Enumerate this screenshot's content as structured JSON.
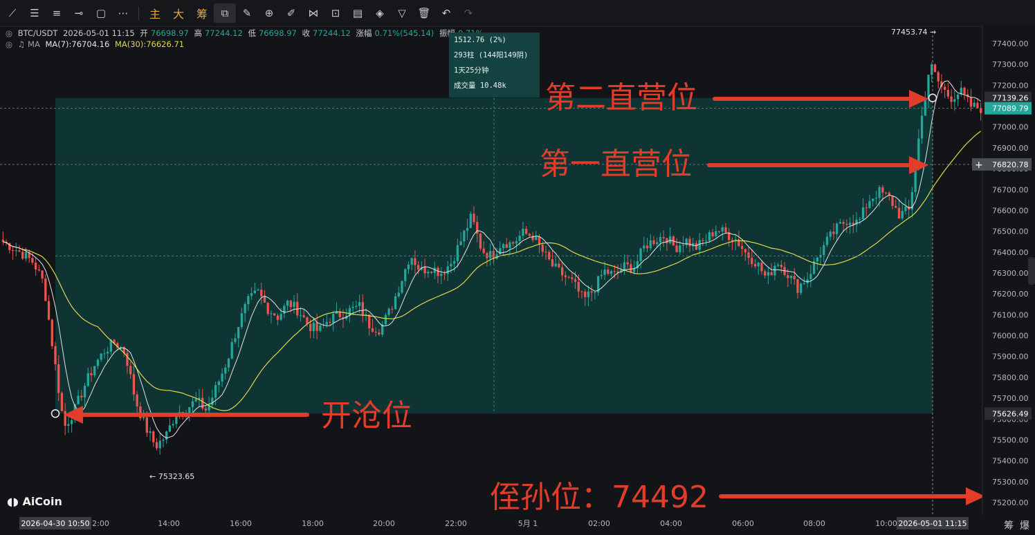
{
  "toolbar": {
    "icons": [
      "line-icon",
      "parallel-icon",
      "channel-icon",
      "hline-icon",
      "rect-icon",
      "more-icon",
      "select-icon",
      "ruler-icon",
      "zoom-icon",
      "brush-icon",
      "pattern-icon",
      "lock-icon",
      "note-icon",
      "magnet-icon",
      "filter-icon",
      "trash-icon",
      "undo-icon",
      "redo-icon"
    ],
    "text_buttons": [
      "主",
      "大",
      "筹"
    ]
  },
  "legend": {
    "symbol": "BTC/USDT",
    "datetime": "2026-05-01 11:15",
    "open_label": "开",
    "open": "76698.97",
    "high_label": "高",
    "high": "77244.12",
    "low_label": "低",
    "low": "76698.97",
    "close_label": "收",
    "close": "77244.12",
    "change_label": "涨幅",
    "change": "0.71%(545.14)",
    "amp_label": "振幅",
    "amp": "0.71%",
    "ma_label": "MA",
    "ma7": "MA(7):76704.16",
    "ma30": "MA(30):76626.71"
  },
  "measure_tooltip": {
    "diff": "1512.76 (2%)",
    "bars": "293柱 (144阳149阴)",
    "duration": "1天25分钟",
    "volume": "成交量 10.48k"
  },
  "annotations": {
    "second": "第二直营位",
    "first": "第一直营位",
    "open": "开沧位",
    "stop": "侄孙位：74492"
  },
  "logo": "AiCoin",
  "bottom_buttons": [
    "筹",
    "爆"
  ],
  "colors": {
    "up": "#26a69a",
    "down": "#ef5350",
    "ma7": "#e6e6e6",
    "ma30": "#e3d84a",
    "measure_fill": "#0e3a38",
    "annotation": "#e23d2a"
  },
  "chart_data": {
    "type": "candlestick",
    "symbol": "BTC/USDT",
    "ylim": [
      75120,
      77500
    ],
    "y_ticks": [
      77400,
      77300,
      77200,
      77100,
      77000,
      76900,
      76800,
      76700,
      76600,
      76500,
      76400,
      76300,
      76200,
      76100,
      76000,
      75900,
      75800,
      75700,
      75600,
      75500,
      75400,
      75300,
      75200
    ],
    "x_ticks": [
      "12:00",
      "14:00",
      "16:00",
      "18:00",
      "20:00",
      "22:00",
      "5月 1",
      "02:00",
      "04:00",
      "06:00",
      "08:00",
      "10:00"
    ],
    "x_start_label": "2026-04-30 10:50",
    "x_end_label": "2026-05-01 11:15",
    "price_tags": {
      "second_entry": "77139.26",
      "current": "77089.79",
      "first_entry": "76820.78",
      "open_entry": "75626.49"
    },
    "high_marker": "77453.74",
    "low_marker": "75323.65",
    "measure_range": {
      "low": 75626.49,
      "high": 77139.26
    },
    "close_path": [
      76450,
      76420,
      76390,
      76350,
      76250,
      75900,
      75560,
      75640,
      75760,
      75860,
      75930,
      75970,
      75920,
      75690,
      75560,
      75470,
      75520,
      75630,
      75650,
      75690,
      75640,
      75760,
      75880,
      76040,
      76160,
      76210,
      76130,
      76090,
      76160,
      76120,
      76050,
      76020,
      76080,
      76100,
      76120,
      76140,
      76050,
      76030,
      76120,
      76250,
      76390,
      76310,
      76330,
      76300,
      76350,
      76460,
      76570,
      76410,
      76380,
      76450,
      76440,
      76490,
      76480,
      76400,
      76330,
      76290,
      76250,
      76170,
      76220,
      76310,
      76290,
      76330,
      76330,
      76430,
      76460,
      76480,
      76420,
      76460,
      76420,
      76460,
      76510,
      76490,
      76460,
      76390,
      76350,
      76270,
      76360,
      76300,
      76230,
      76280,
      76380,
      76460,
      76520,
      76560,
      76540,
      76650,
      76690,
      76660,
      76580,
      76600,
      76980,
      77300,
      77200,
      77140,
      77170,
      77100,
      77090
    ]
  }
}
